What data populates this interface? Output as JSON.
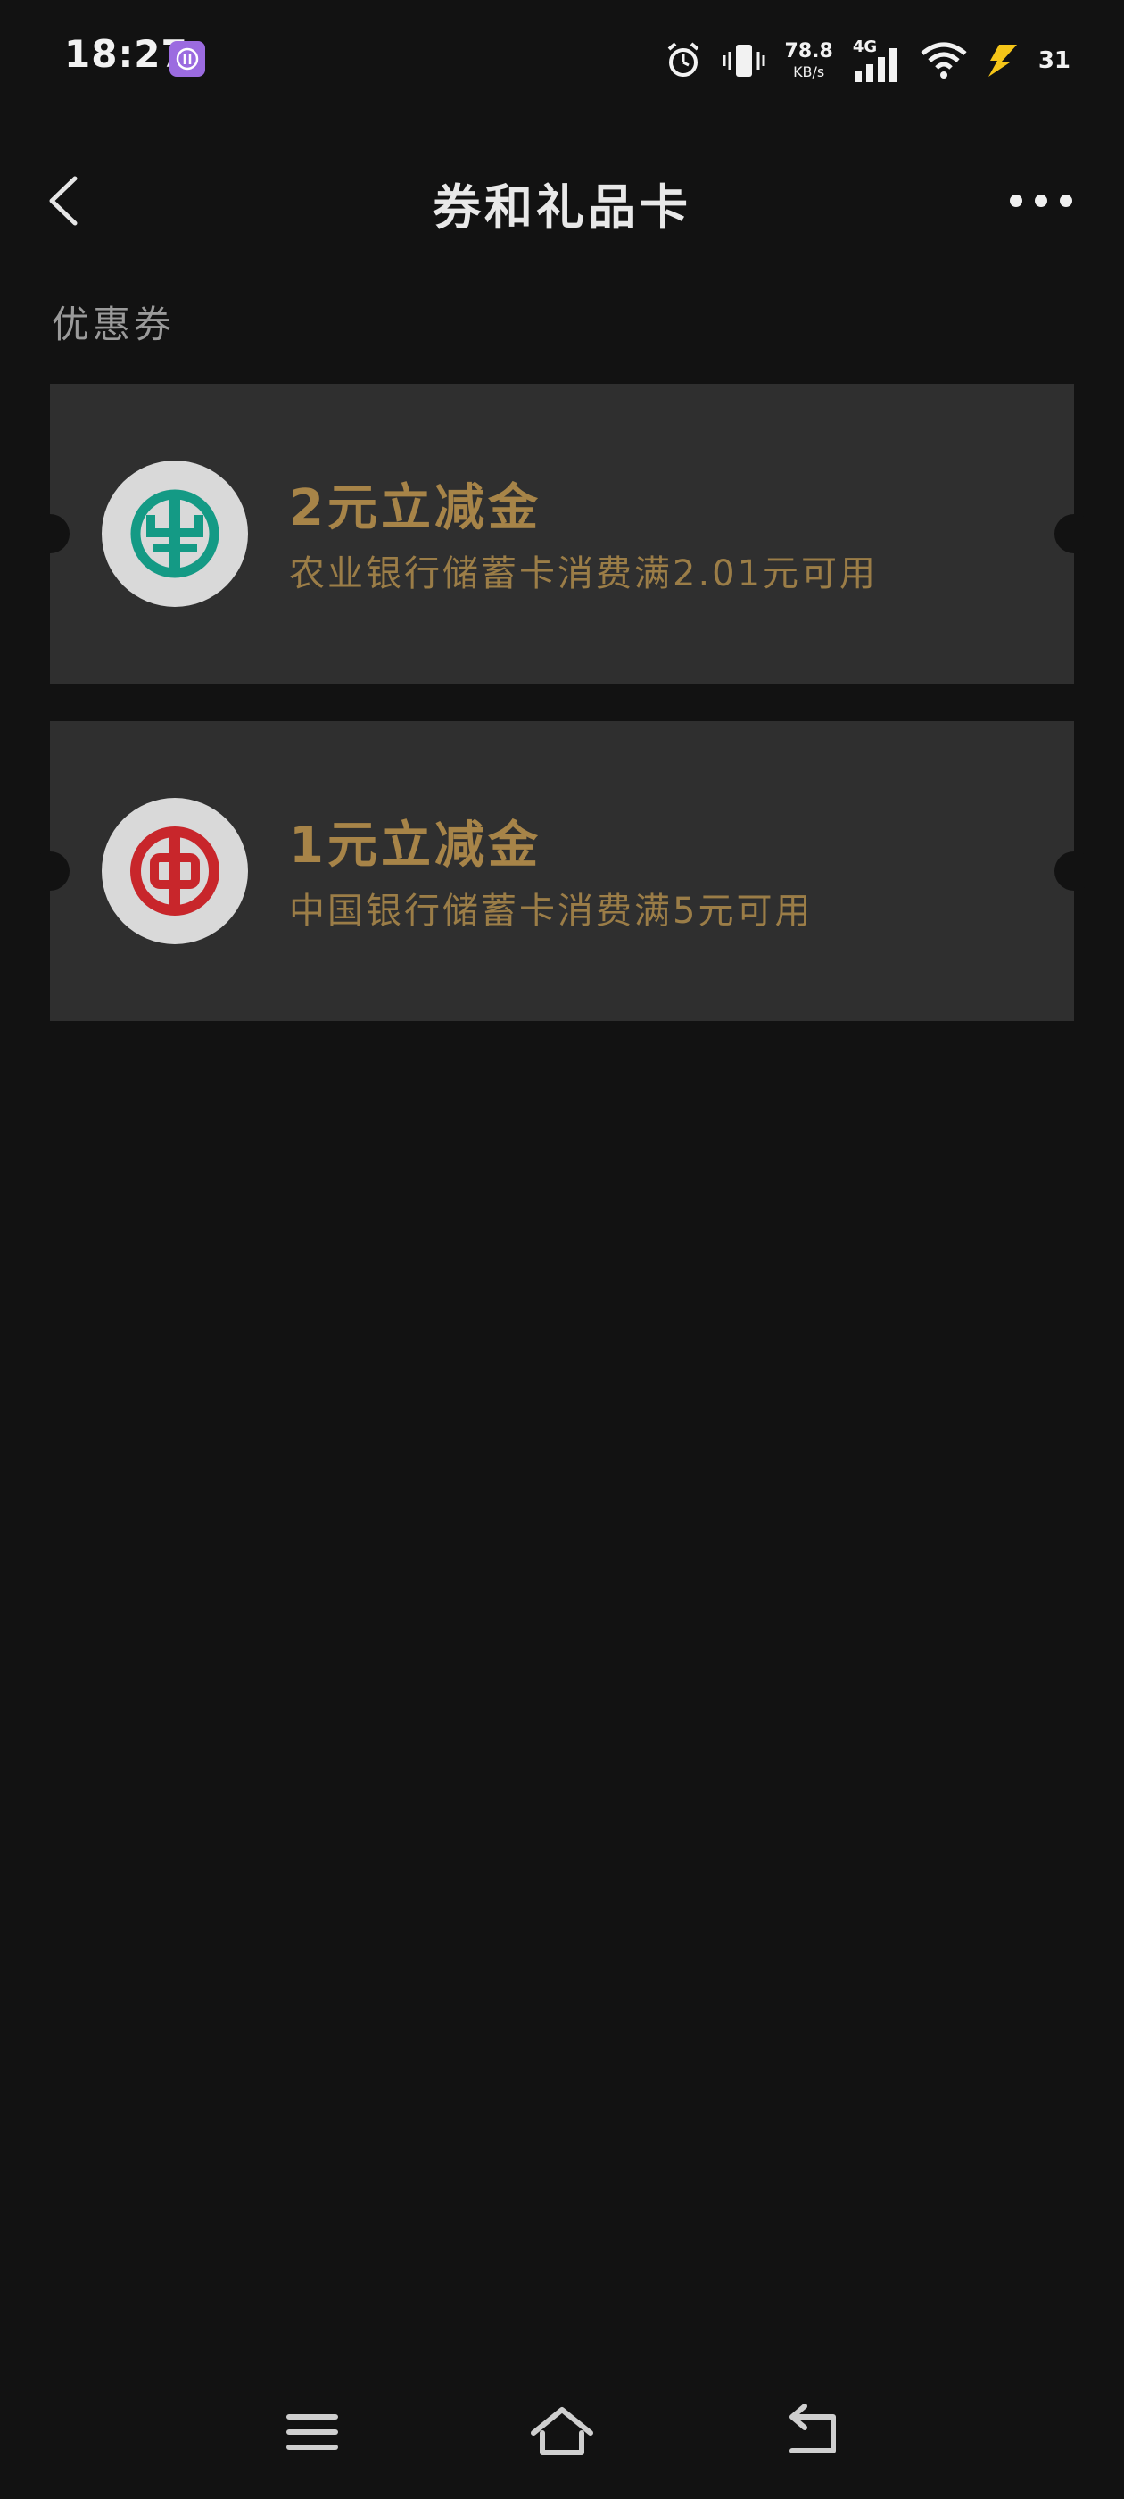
{
  "status_bar": {
    "time": "18:27",
    "net_speed_value": "78.8",
    "net_speed_unit": "KB/s",
    "network_type": "4G",
    "battery": "31",
    "icons": [
      "app-notification-icon",
      "alarm-icon",
      "vibrate-icon",
      "signal-icon",
      "wifi-icon",
      "charging-icon"
    ]
  },
  "header": {
    "title": "券和礼品卡"
  },
  "section": {
    "title": "优惠券"
  },
  "coupons": [
    {
      "amount": "2元立减金",
      "description": "农业银行储蓄卡消费满2.01元可用",
      "logo": "abc-bank-logo-icon",
      "logo_color": "#149a85"
    },
    {
      "amount": "1元立减金",
      "description": "中国银行储蓄卡消费满5元可用",
      "logo": "boc-bank-logo-icon",
      "logo_color": "#c8262b"
    }
  ],
  "colors": {
    "background": "#121212",
    "card": "#2f2f2f",
    "accent_gold": "#a78448"
  }
}
